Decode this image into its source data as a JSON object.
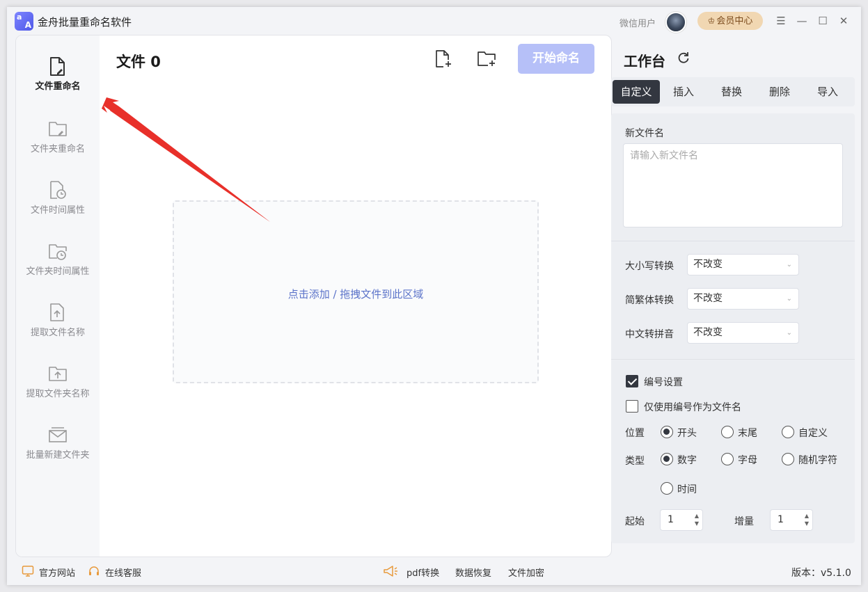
{
  "app": {
    "logo_top": "a",
    "logo_bottom": "A",
    "title": "金舟批量重命名软件",
    "user_name": "微信用户",
    "vip_label": "会员中心"
  },
  "window_controls": {
    "menu": "☰",
    "minimize": "—",
    "maximize": "☐",
    "close": "✕"
  },
  "sidebar": {
    "items": [
      {
        "label": "文件重命名",
        "icon": "file-edit-icon",
        "active": true
      },
      {
        "label": "文件夹重命名",
        "icon": "folder-edit-icon",
        "active": false
      },
      {
        "label": "文件时间属性",
        "icon": "file-clock-icon",
        "active": false
      },
      {
        "label": "文件夹时间属性",
        "icon": "folder-clock-icon",
        "active": false
      },
      {
        "label": "提取文件名称",
        "icon": "file-upload-icon",
        "active": false
      },
      {
        "label": "提取文件夹名称",
        "icon": "folder-upload-icon",
        "active": false
      },
      {
        "label": "批量新建文件夹",
        "icon": "folder-batch-icon",
        "active": false
      }
    ]
  },
  "main": {
    "files_title": "文件 0",
    "add_file_icon": "file-add-icon",
    "add_folder_icon": "folder-add-icon",
    "start_label": "开始命名",
    "dropzone_hint": "点击添加 / 拖拽文件到此区域"
  },
  "workbench": {
    "title": "工作台",
    "tabs": [
      {
        "label": "自定义",
        "active": true
      },
      {
        "label": "插入",
        "active": false
      },
      {
        "label": "替换",
        "active": false
      },
      {
        "label": "删除",
        "active": false
      },
      {
        "label": "导入",
        "active": false
      }
    ],
    "new_name_label": "新文件名",
    "new_name_placeholder": "请输入新文件名",
    "case_label": "大小写转换",
    "case_value": "不改变",
    "trad_label": "简繁体转换",
    "trad_value": "不改变",
    "pinyin_label": "中文转拼音",
    "pinyin_value": "不改变",
    "numbering_label": "编号设置",
    "numbering_checked": true,
    "only_number_label": "仅使用编号作为文件名",
    "only_number_checked": false,
    "position_label": "位置",
    "position_options": [
      "开头",
      "末尾",
      "自定义"
    ],
    "position_selected": "开头",
    "type_label": "类型",
    "type_options": [
      "数字",
      "字母",
      "随机字符",
      "时间"
    ],
    "type_selected": "数字",
    "start_label": "起始",
    "start_value": "1",
    "step_label": "增量",
    "step_value": "1"
  },
  "footer": {
    "website": "官方网站",
    "support": "在线客服",
    "pdf": "pdf转换",
    "recovery": "数据恢复",
    "encrypt": "文件加密",
    "version": "版本：v5.1.0"
  },
  "colors": {
    "accent": "#b6c0f8",
    "dark": "#333740",
    "hint": "#5b73c9",
    "arrow": "#e8302a"
  }
}
